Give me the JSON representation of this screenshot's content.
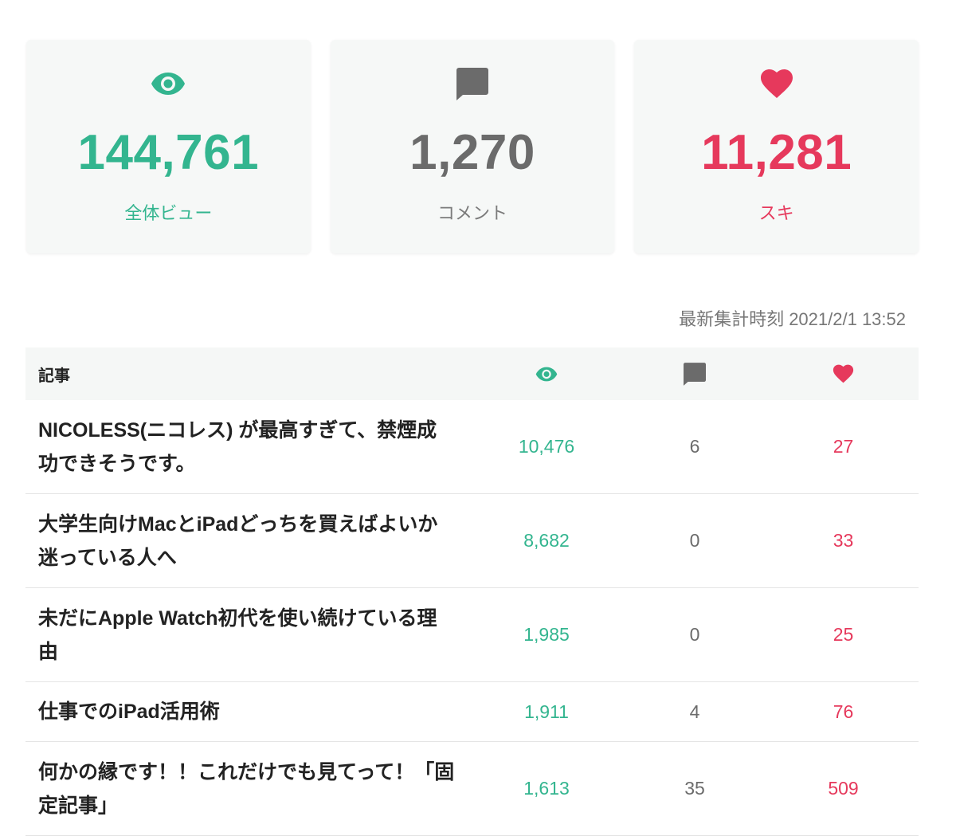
{
  "stats": [
    {
      "icon": "eye-icon",
      "value": "144,761",
      "label": "全体ビュー"
    },
    {
      "icon": "comment-icon",
      "value": "1,270",
      "label": "コメント"
    },
    {
      "icon": "heart-icon",
      "value": "11,281",
      "label": "スキ"
    }
  ],
  "updated": "最新集計時刻 2021/2/1 13:52",
  "table": {
    "header": {
      "article": "記事",
      "views_icon": "eye-icon",
      "comments_icon": "comment-icon",
      "likes_icon": "heart-icon"
    },
    "rows": [
      {
        "title": "NICOLESS(ニコレス) が最高すぎて、禁煙成功できそうです。",
        "views": "10,476",
        "comments": "6",
        "likes": "27"
      },
      {
        "title": "大学生向けMacとiPadどっちを買えばよいか迷っている人へ",
        "views": "8,682",
        "comments": "0",
        "likes": "33"
      },
      {
        "title": "未だにApple Watch初代を使い続けている理由",
        "views": "1,985",
        "comments": "0",
        "likes": "25"
      },
      {
        "title": "仕事でのiPad活用術",
        "views": "1,911",
        "comments": "4",
        "likes": "76"
      },
      {
        "title": "何かの縁です！！これだけでも見てって！「固定記事」",
        "views": "1,613",
        "comments": "35",
        "likes": "509"
      }
    ]
  },
  "colors": {
    "views": "#33b58f",
    "comments": "#6b6b6b",
    "comments_label": "#7b7b7b",
    "likes": "#e6395c"
  }
}
